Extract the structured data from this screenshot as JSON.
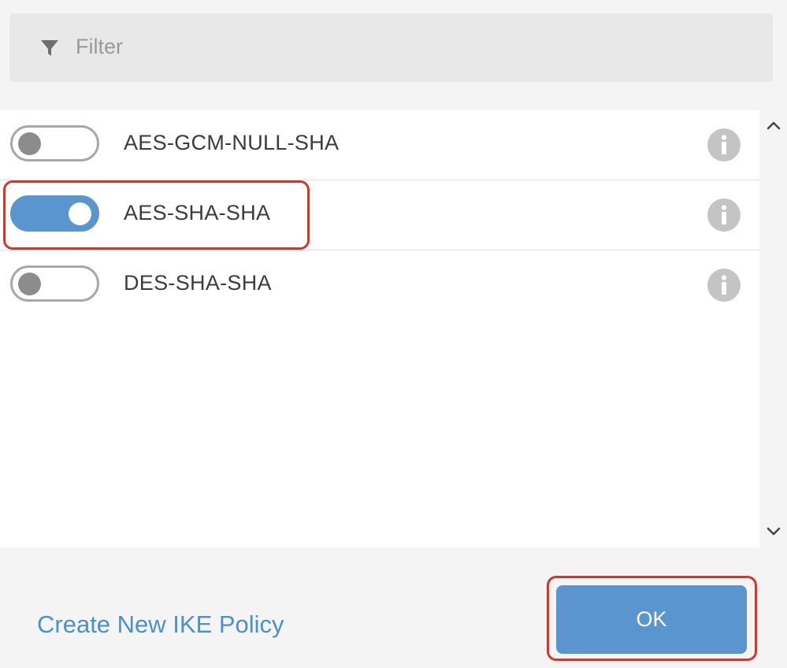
{
  "filter": {
    "placeholder": "Filter",
    "icon": "filter-icon"
  },
  "policies": [
    {
      "label": "AES-GCM-NULL-SHA",
      "enabled": false,
      "icon": "info-icon"
    },
    {
      "label": "AES-SHA-SHA",
      "enabled": true,
      "icon": "info-icon"
    },
    {
      "label": "DES-SHA-SHA",
      "enabled": false,
      "icon": "info-icon"
    }
  ],
  "footer": {
    "create_link": "Create New IKE Policy",
    "ok_label": "OK"
  },
  "colors": {
    "accent": "#5b95d0",
    "link": "#4a90cf",
    "highlight": "#d8352a",
    "toggle_off_knob": "#8c8c8c"
  }
}
